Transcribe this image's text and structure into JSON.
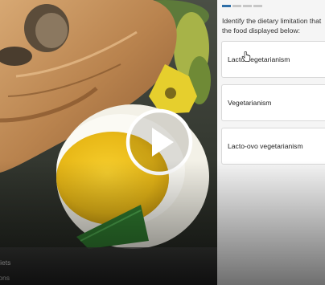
{
  "media": {
    "play_icon": "play-icon",
    "captions": [
      "Diets",
      "tions"
    ]
  },
  "quiz": {
    "progress": {
      "total": 4,
      "current": 1
    },
    "question": "Identify the dietary limitation that\nthe food displayed below:",
    "options": [
      {
        "label": "Lacto-vegetarianism"
      },
      {
        "label": "Vegetarianism"
      },
      {
        "label": "Lacto-ovo vegetarianism"
      }
    ]
  }
}
